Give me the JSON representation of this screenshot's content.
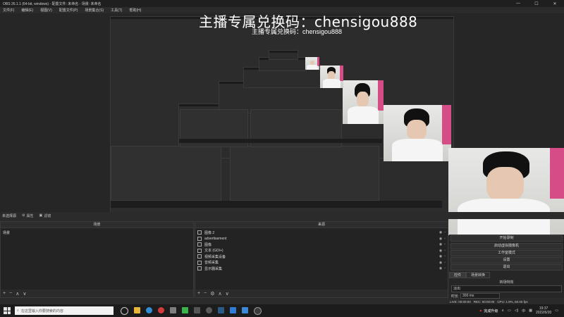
{
  "window": {
    "title": "OBS 26.1.1 (64-bit, windows) - 配置文件: 未命名 - 场景: 未命名",
    "controls": [
      "—",
      "☐",
      "✕"
    ]
  },
  "menu": [
    "文件(F)",
    "编辑(E)",
    "视图(V)",
    "配置文件(P)",
    "场景集合(S)",
    "工具(T)",
    "帮助(H)"
  ],
  "overlay": {
    "text": "主播专属兑换码：chensigou888",
    "small_text": "主播专属兑换码：chensigou888"
  },
  "toolbar": {
    "no_source": "未选择源",
    "properties": "属性",
    "filters": "滤镜"
  },
  "scenes": {
    "header": "场景",
    "items": [
      "场景"
    ]
  },
  "sources": {
    "header": "来源",
    "items": [
      "图像 2",
      "advertisement",
      "图像",
      "文本 (GDI+)",
      "视频采集设备",
      "音频采集",
      "显示器采集"
    ]
  },
  "controls": {
    "buttons": [
      "开始录制",
      "启动虚拟摄像机",
      "工作室模式",
      "设置",
      "退出"
    ],
    "tabs": [
      "控件",
      "场景转换"
    ],
    "transition_label": "转场特效",
    "transition_value": "淡出",
    "duration_label": "时长",
    "duration_value": "300 ms"
  },
  "status": {
    "live": "LIVE: 00:00:00",
    "rec": "REC: 00:00:00",
    "cpu": "CPU: 1.9%, 60.00 fps"
  },
  "taskbar": {
    "search_placeholder": "在这里输入你要搜索的内容",
    "alert": "完成升级",
    "ime": "中",
    "time": "19:37",
    "date": "2022/6/20"
  },
  "colors": {
    "accent_pink": "#d54c87",
    "bg": "#2b2b2b"
  }
}
